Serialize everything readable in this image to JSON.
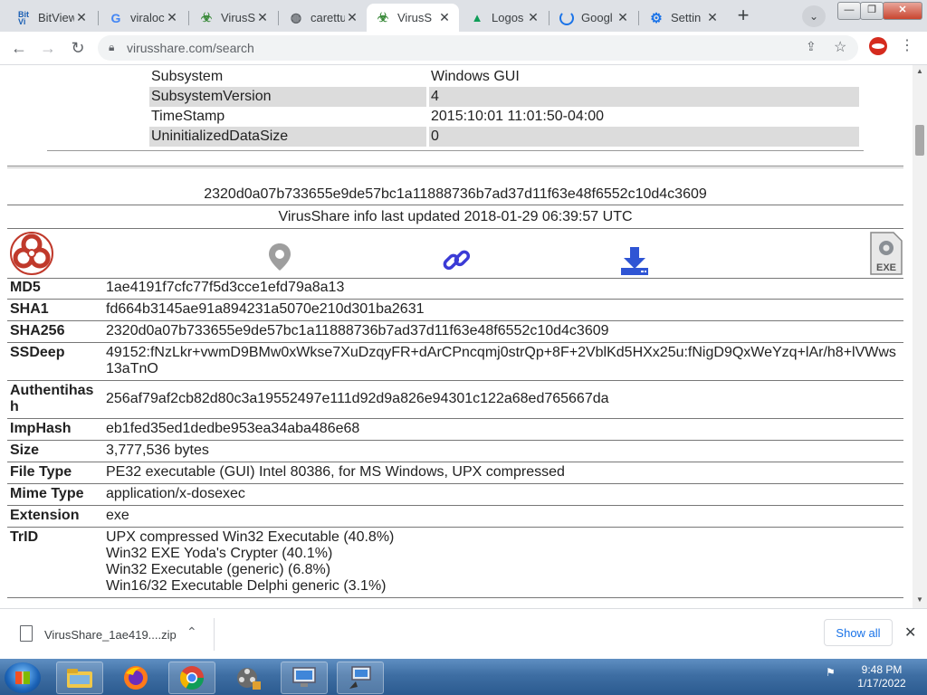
{
  "tabs": [
    {
      "title": "BitView",
      "icon": "bitview-icon",
      "active": false
    },
    {
      "title": "viraloc",
      "icon": "google-icon",
      "active": false
    },
    {
      "title": "VirusSh",
      "icon": "virusshare-icon",
      "active": false
    },
    {
      "title": "carettu",
      "icon": "globe-icon",
      "active": false
    },
    {
      "title": "VirusS",
      "icon": "virusshare-icon",
      "active": true
    },
    {
      "title": "Logos",
      "icon": "drive-icon",
      "active": false
    },
    {
      "title": "Googl",
      "icon": "loading-icon",
      "active": false
    },
    {
      "title": "Settin",
      "icon": "settings-icon",
      "active": false
    }
  ],
  "toolbar": {
    "url": "virusshare.com/search",
    "back_icon": "arrow-left-icon",
    "forward_icon": "arrow-right-icon",
    "reload_icon": "reload-icon"
  },
  "pe_table": [
    {
      "key": "Subsystem",
      "value": "Windows GUI",
      "shaded": false
    },
    {
      "key": "SubsystemVersion",
      "value": "4",
      "shaded": true
    },
    {
      "key": "TimeStamp",
      "value": "2015:10:01 11:01:50-04:00",
      "shaded": false
    },
    {
      "key": "UninitializedDataSize",
      "value": "0",
      "shaded": true
    }
  ],
  "sha256_header": "2320d0a07b733655e9de57bc1a11888736b7ad37d11f63e48f6552c10d4c3609",
  "info_updated": "VirusShare info last updated 2018-01-29 06:39:57 UTC",
  "actions": {
    "biohazard": "biohazard-icon",
    "location": "map-pin-icon",
    "link": "link-icon",
    "download": "download-icon",
    "exe": "EXE"
  },
  "hash_table": [
    {
      "key": "MD5",
      "value": "1ae4191f7cfc77f5d3cce1efd79a8a13"
    },
    {
      "key": "SHA1",
      "value": "fd664b3145ae91a894231a5070e210d301ba2631"
    },
    {
      "key": "SHA256",
      "value": "2320d0a07b733655e9de57bc1a11888736b7ad37d11f63e48f6552c10d4c3609"
    },
    {
      "key": "SSDeep",
      "value": "49152:fNzLkr+vwmD9BMw0xWkse7XuDzqyFR+dArCPncqmj0strQp+8F+2VblKd5HXx25u:fNigD9QxWeYzq+lAr/h8+lVWws13aTnO"
    },
    {
      "key": "Authentihash",
      "value": "256af79af2cb82d80c3a19552497e111d92d9a826e94301c122a68ed765667da"
    },
    {
      "key": "ImpHash",
      "value": "eb1fed35ed1dedbe953ea34aba486e68"
    },
    {
      "key": "Size",
      "value": "3,777,536 bytes"
    },
    {
      "key": "File Type",
      "value": "PE32 executable (GUI) Intel 80386, for MS Windows, UPX compressed"
    },
    {
      "key": "Mime Type",
      "value": "application/x-dosexec"
    },
    {
      "key": "Extension",
      "value": "exe"
    }
  ],
  "trid": {
    "key": "TrID",
    "lines": [
      "UPX compressed Win32 Executable (40.8%)",
      "Win32 EXE Yoda's Crypter (40.1%)",
      "Win32 Executable (generic) (6.8%)",
      "Win16/32 Executable Delphi generic (3.1%)"
    ]
  },
  "download_bar": {
    "file_name": "VirusShare_1ae419....zip",
    "show_all": "Show all"
  },
  "taskbar": {
    "time": "9:48 PM",
    "date": "1/17/2022"
  }
}
